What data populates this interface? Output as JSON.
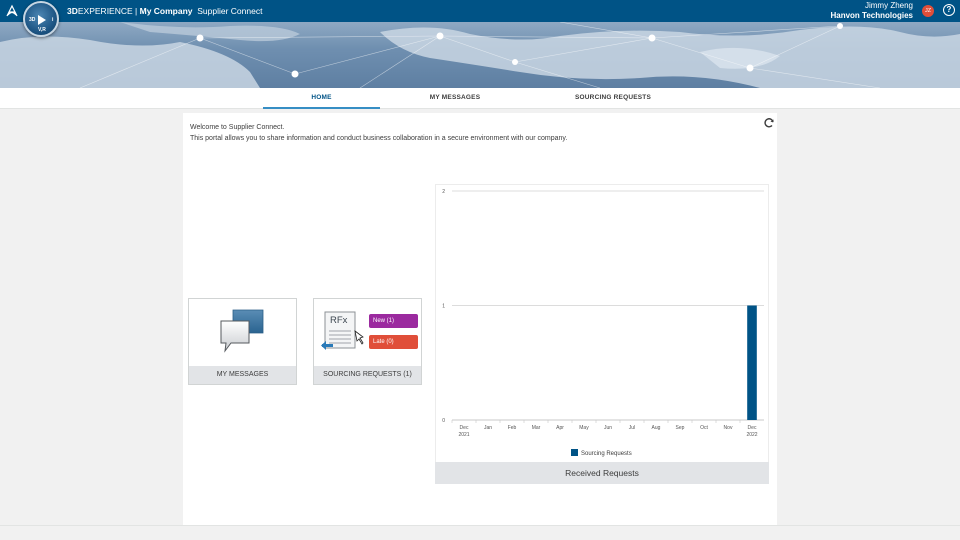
{
  "topbar": {
    "brand_prefix": "3D",
    "brand_suffix": "EXPERIENCE",
    "separator": " | ",
    "company": "My Company",
    "app_name": "Supplier Connect",
    "compass_labels": [
      "3D",
      "V,R",
      "i"
    ],
    "user_name": "Jimmy Zheng",
    "user_company": "Hanvon Technologies",
    "user_initials": "JZ",
    "help_symbol": "?",
    "icons": {
      "logo": "3ds-logo-icon",
      "compass": "compass-icon",
      "help": "help-icon"
    }
  },
  "tabs": [
    {
      "label": "HOME",
      "active": true
    },
    {
      "label": "MY MESSAGES",
      "active": false
    },
    {
      "label": "SOURCING REQUESTS",
      "active": false
    }
  ],
  "welcome": {
    "line1": "Welcome to Supplier Connect.",
    "line2": "This portal allows you to share information and conduct business collaboration in a secure environment with our company."
  },
  "tiles": {
    "messages": {
      "label": "MY MESSAGES",
      "icon": "chat-bubbles-icon"
    },
    "sourcing": {
      "label": "SOURCING REQUESTS (1)",
      "icon": "rfx-document-icon",
      "icon_text": "RFx",
      "badge_new": "New (1)",
      "badge_late": "Late (0)"
    }
  },
  "colors": {
    "topbar": "#005386",
    "accent": "#368ec4",
    "bar": "#005386",
    "badge_new": "#9b2a9f",
    "badge_late": "#e04e39",
    "avatar": "#e04e39"
  },
  "chart_data": {
    "type": "bar",
    "title": "Received Requests",
    "categories": [
      "Dec 2021",
      "Jan",
      "Feb",
      "Mar",
      "Apr",
      "May",
      "Jun",
      "Jul",
      "Aug",
      "Sep",
      "Oct",
      "Nov",
      "Dec 2022"
    ],
    "category_lines": [
      [
        "Dec",
        "2021"
      ],
      [
        "Jan"
      ],
      [
        "Feb"
      ],
      [
        "Mar"
      ],
      [
        "Apr"
      ],
      [
        "May"
      ],
      [
        "Jun"
      ],
      [
        "Jul"
      ],
      [
        "Aug"
      ],
      [
        "Sep"
      ],
      [
        "Oct"
      ],
      [
        "Nov"
      ],
      [
        "Dec",
        "2022"
      ]
    ],
    "series": [
      {
        "name": "Sourcing Requests",
        "values": [
          0,
          0,
          0,
          0,
          0,
          0,
          0,
          0,
          0,
          0,
          0,
          0,
          1
        ]
      }
    ],
    "y_ticks": [
      0,
      1,
      2
    ],
    "ylim": [
      0,
      2
    ],
    "grid": true,
    "legend_position": "bottom"
  }
}
